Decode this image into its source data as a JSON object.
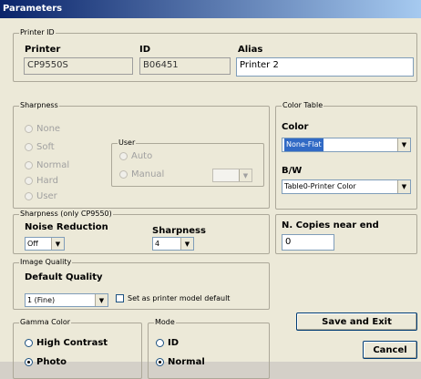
{
  "window": {
    "title": "Parameters"
  },
  "printer_id": {
    "legend": "Printer ID",
    "printer_label": "Printer",
    "printer_value": "CP9550S",
    "id_label": "ID",
    "id_value": "B06451",
    "alias_label": "Alias",
    "alias_value": "Printer 2"
  },
  "sharpness": {
    "legend": "Sharpness",
    "options": [
      "None",
      "Soft",
      "Normal",
      "Hard",
      "User"
    ],
    "user_group": {
      "legend": "User",
      "auto_label": "Auto",
      "manual_label": "Manual",
      "manual_value": ""
    }
  },
  "sharpness_cp9550": {
    "legend": "Sharpness (only CP9550)",
    "noise_label": "Noise Reduction",
    "noise_value": "Off",
    "sharpness_label": "Sharpness",
    "sharpness_value": "4"
  },
  "image_quality": {
    "legend": "Image Quality",
    "label": "Default Quality",
    "value": "1 (Fine)",
    "checkbox_label": "Set as printer model default",
    "checked": false
  },
  "gamma": {
    "legend": "Gamma Color",
    "option1": "High Contrast",
    "option2": "Photo",
    "selected": "Photo"
  },
  "mode": {
    "legend": "Mode",
    "option1": "ID",
    "option2": "Normal",
    "selected": "Normal"
  },
  "color_table": {
    "legend": "Color Table",
    "color_label": "Color",
    "color_value": "None-Flat",
    "bw_label": "B/W",
    "bw_value": "Table0-Printer Color"
  },
  "copies": {
    "label": "N. Copies near end",
    "value": "0"
  },
  "buttons": {
    "save": "Save and Exit",
    "cancel": "Cancel"
  },
  "icons": {
    "dropdown": "▼"
  }
}
